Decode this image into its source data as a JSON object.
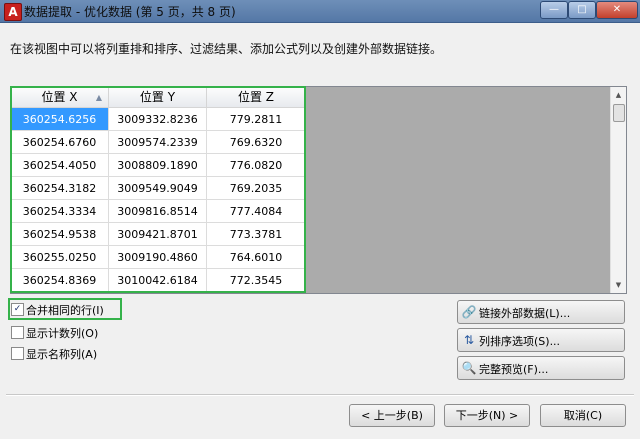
{
  "window": {
    "title": "数据提取 - 优化数据 (第 5 页，共 8 页)",
    "app_icon_letter": "A",
    "controls": {
      "minimize": "—",
      "maximize": "□",
      "close": "✕"
    }
  },
  "description": "在该视图中可以将列重排和排序、过滤结果、添加公式列以及创建外部数据链接。",
  "table": {
    "columns": [
      "位置 X",
      "位置 Y",
      "位置 Z"
    ],
    "sort_indicator": "▲",
    "rows": [
      [
        "360254.6256",
        "3009332.8236",
        "779.2811"
      ],
      [
        "360254.6760",
        "3009574.2339",
        "769.6320"
      ],
      [
        "360254.4050",
        "3008809.1890",
        "776.0820"
      ],
      [
        "360254.3182",
        "3009549.9049",
        "769.2035"
      ],
      [
        "360254.3334",
        "3009816.8514",
        "777.4084"
      ],
      [
        "360254.9538",
        "3009421.8701",
        "773.3781"
      ],
      [
        "360255.0250",
        "3009190.4860",
        "764.6010"
      ],
      [
        "360254.8369",
        "3010042.6184",
        "772.3545"
      ]
    ],
    "scroll_up": "▲",
    "scroll_down": "▼"
  },
  "options": [
    {
      "label": "合并相同的行(I)",
      "checked": true,
      "mark": "✓"
    },
    {
      "label": "显示计数列(O)",
      "checked": false,
      "mark": ""
    },
    {
      "label": "显示名称列(A)",
      "checked": false,
      "mark": ""
    }
  ],
  "side_buttons": [
    {
      "label": "链接外部数据(L)...",
      "icon": "link-icon",
      "glyph": "🔗"
    },
    {
      "label": "列排序选项(S)...",
      "icon": "sort-az-icon",
      "glyph": "⇅"
    },
    {
      "label": "完整预览(F)...",
      "icon": "preview-icon",
      "glyph": "🔍"
    }
  ],
  "nav": {
    "back": "< 上一步(B)",
    "next": "下一步(N) >",
    "cancel": "取消(C)"
  },
  "colors": {
    "highlight": "#35b24a",
    "selection": "#3399ff"
  }
}
